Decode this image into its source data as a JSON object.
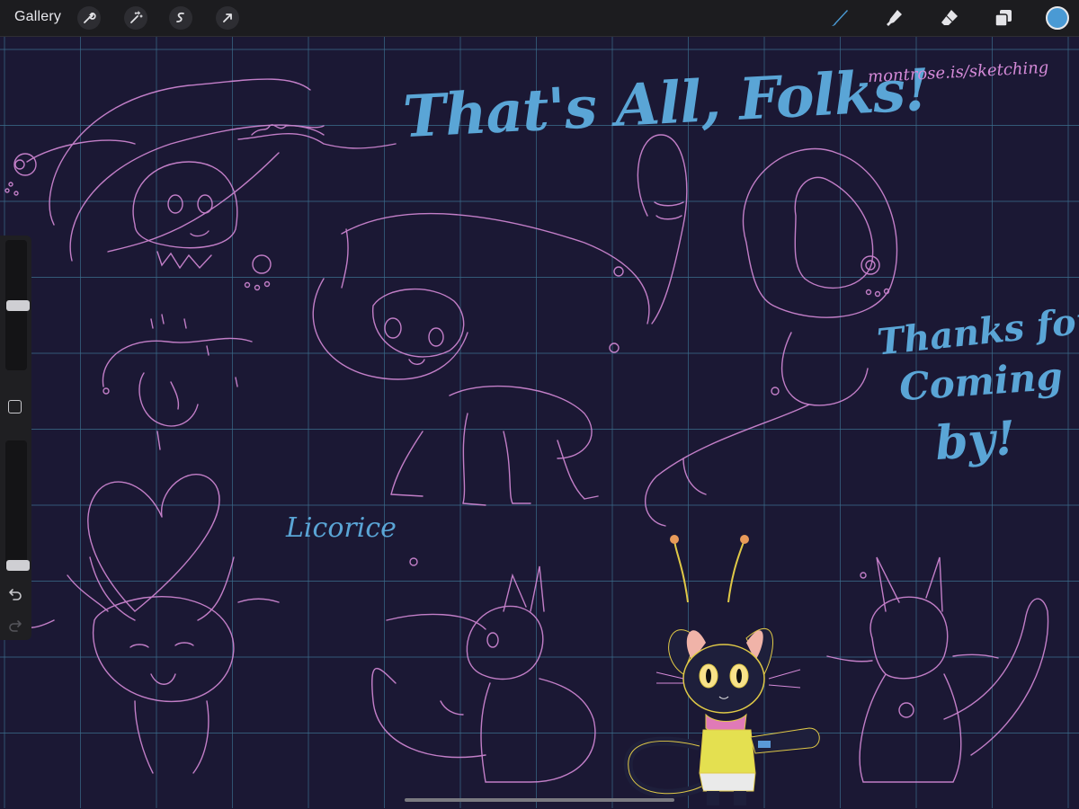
{
  "toolbar": {
    "gallery_label": "Gallery",
    "left_tools": [
      "wrench-icon",
      "magic-wand-icon",
      "selection-icon",
      "transform-arrow-icon"
    ],
    "right_tools": [
      "brush-icon",
      "smudge-icon",
      "eraser-icon",
      "layers-icon"
    ],
    "current_color": "#4a9ad4",
    "active_tool_color": "#4a9ad4"
  },
  "sidebar": {
    "brush_size_level": 0.5,
    "opacity_level": 0.0,
    "icons": [
      "modify-square-icon",
      "undo-icon",
      "redo-icon"
    ]
  },
  "canvas": {
    "background_color": "#1b1834",
    "grid_color": "#3c6f8e",
    "sketch_color": "#d58ad8",
    "lettering_color": "#5aa5d6",
    "title_text": "That's All, Folks!",
    "url_text": "montrose.is/sketching",
    "thanks_lines": [
      "Thanks for",
      "Coming",
      "by!"
    ],
    "character_name": "Licorice"
  }
}
